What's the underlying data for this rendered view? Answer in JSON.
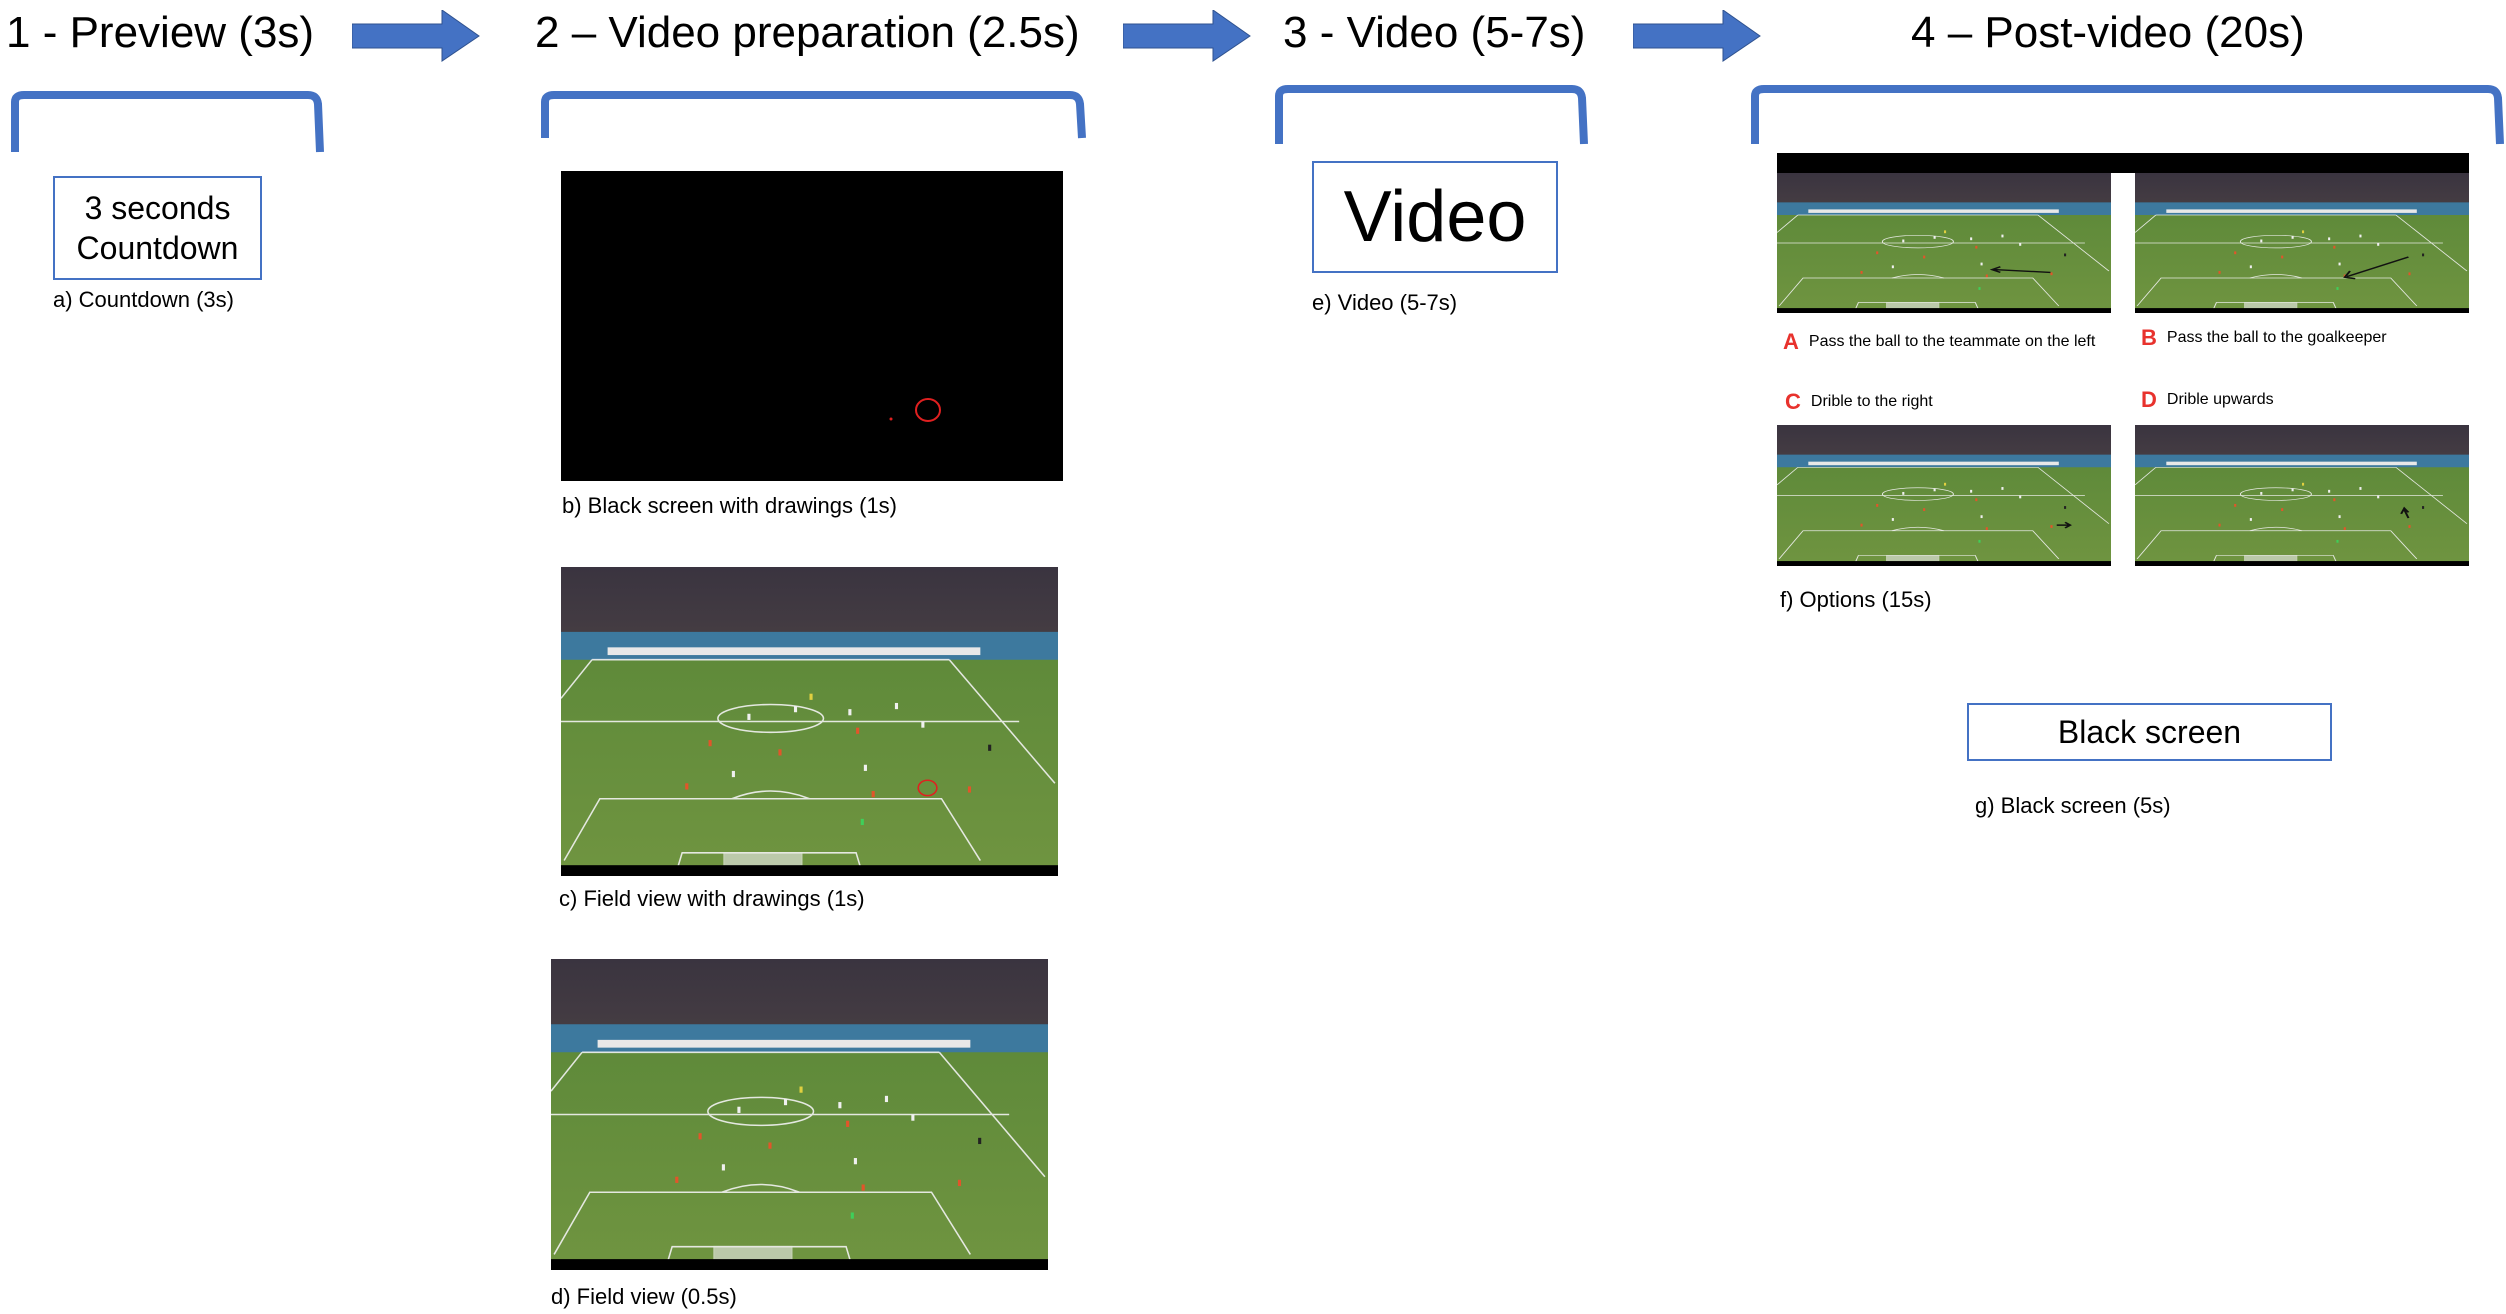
{
  "stages": [
    {
      "title": "1 - Preview (3s)"
    },
    {
      "title": "2 – Video preparation (2.5s)"
    },
    {
      "title": "3 - Video (5-7s)"
    },
    {
      "title": "4 – Post-video (20s)"
    }
  ],
  "countdown_box": {
    "line1": "3 seconds",
    "line2": "Countdown",
    "caption": "a) Countdown (3s)"
  },
  "black_drawings": {
    "caption": "b) Black screen with drawings (1s)"
  },
  "field_drawings": {
    "caption": "c)  Field view with drawings (1s)"
  },
  "field_view": {
    "caption": "d) Field view (0.5s)"
  },
  "video_box": {
    "label": "Video",
    "caption": "e) Video (5-7s)"
  },
  "options": {
    "caption": "f) Options (15s)",
    "items": [
      {
        "letter": "A",
        "text": "Pass the ball to the teammate on the left"
      },
      {
        "letter": "B",
        "text": "Pass the ball to the goalkeeper"
      },
      {
        "letter": "C",
        "text": "Drible to the right"
      },
      {
        "letter": "D",
        "text": "Drible upwards"
      }
    ]
  },
  "black_screen_box": {
    "label": "Black screen",
    "caption": "g) Black screen (5s)"
  },
  "colors": {
    "accent": "#4472c4",
    "option_letter": "#e8322d",
    "drawing": "#e02020"
  }
}
